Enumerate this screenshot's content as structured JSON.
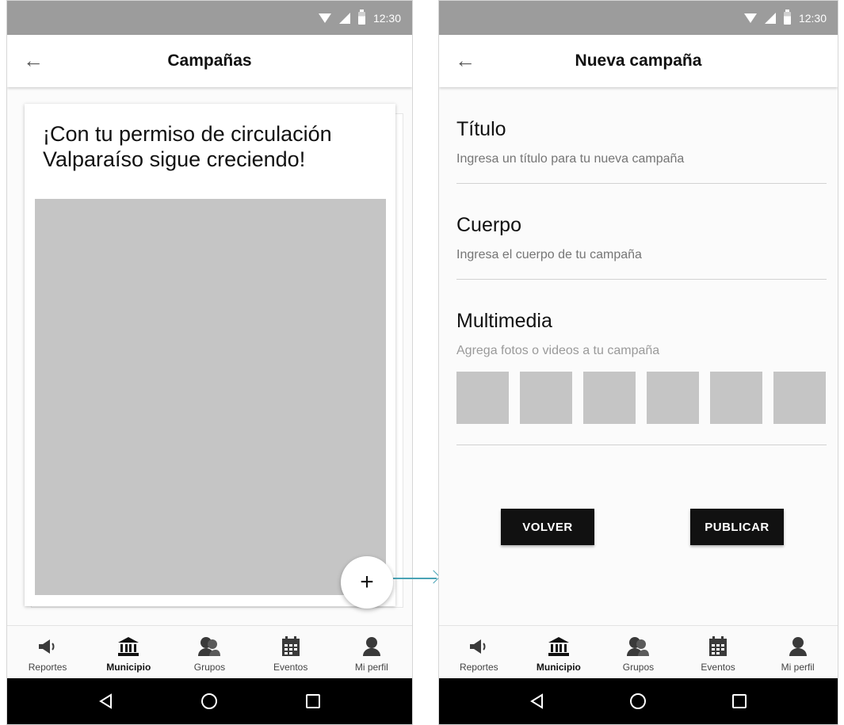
{
  "status_bar": {
    "time": "12:30"
  },
  "left_screen": {
    "title": "Campañas",
    "card": {
      "title": "¡Con tu permiso de circulación Valparaíso sigue creciendo!"
    },
    "fab_label": "+"
  },
  "right_screen": {
    "title": "Nueva campaña",
    "fields": {
      "titulo": {
        "label": "Título",
        "placeholder": "Ingresa un título para tu nueva campaña"
      },
      "cuerpo": {
        "label": "Cuerpo",
        "placeholder": "Ingresa el cuerpo de tu campaña"
      },
      "multimedia": {
        "label": "Multimedia",
        "hint": "Agrega fotos o videos a tu campaña",
        "thumbnail_count": 6
      }
    },
    "buttons": {
      "back": "VOLVER",
      "publish": "PUBLICAR"
    }
  },
  "bottom_nav": {
    "active": "Municipio",
    "items": [
      {
        "label": "Reportes",
        "icon": "megaphone-icon"
      },
      {
        "label": "Municipio",
        "icon": "city-hall-icon"
      },
      {
        "label": "Grupos",
        "icon": "group-icon"
      },
      {
        "label": "Eventos",
        "icon": "calendar-icon"
      },
      {
        "label": "Mi perfil",
        "icon": "profile-icon"
      }
    ]
  },
  "colors": {
    "accent": "#4aa3b5",
    "status_bar": "#9c9c9c",
    "placeholder": "#c5c5c5"
  }
}
